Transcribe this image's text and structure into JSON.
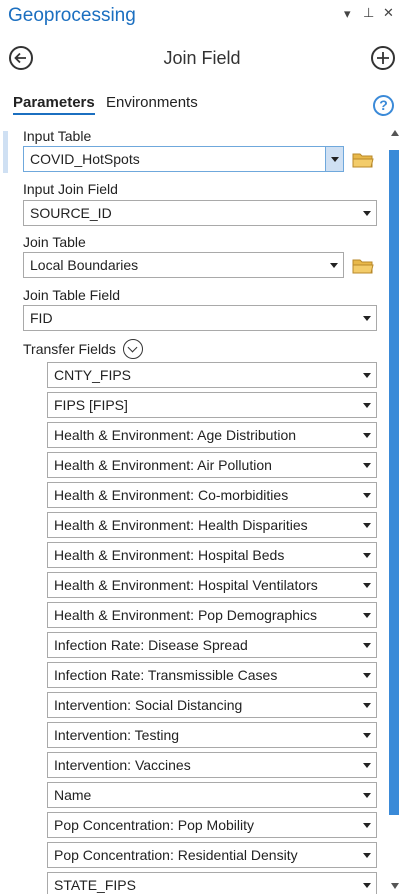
{
  "pane": {
    "title": "Geoprocessing",
    "controls": {
      "dropdown": "▾",
      "pin": "⊥",
      "close": "✕"
    }
  },
  "tool": {
    "title": "Join Field"
  },
  "tabs": [
    {
      "label": "Parameters",
      "active": true
    },
    {
      "label": "Environments",
      "active": false
    }
  ],
  "params": {
    "input_table": {
      "label": "Input Table",
      "value": "COVID_HotSpots"
    },
    "input_join_field": {
      "label": "Input Join Field",
      "value": "SOURCE_ID"
    },
    "join_table": {
      "label": "Join Table",
      "value": "Local Boundaries"
    },
    "join_table_field": {
      "label": "Join Table Field",
      "value": "FID"
    },
    "transfer_fields": {
      "label": "Transfer Fields",
      "items": [
        "CNTY_FIPS",
        "FIPS [FIPS]",
        "Health & Environment: Age Distribution",
        "Health & Environment: Air Pollution",
        "Health & Environment: Co-morbidities",
        "Health & Environment: Health Disparities",
        "Health & Environment: Hospital Beds",
        "Health & Environment: Hospital Ventilators",
        "Health & Environment: Pop Demographics",
        "Infection Rate: Disease Spread",
        "Infection Rate: Transmissible Cases",
        "Intervention: Social Distancing",
        "Intervention: Testing",
        "Intervention: Vaccines",
        "Name",
        "Pop Concentration: Pop Mobility",
        "Pop Concentration: Residential Density",
        "STATE_FIPS"
      ]
    }
  },
  "icons": {
    "back": "back-arrow-icon",
    "add": "plus-icon",
    "help": "?",
    "folder": "folder-icon"
  },
  "colors": {
    "accent": "#1b6fc0",
    "scrollbar": "#3a8ad8",
    "folder": "#e8b84a"
  }
}
